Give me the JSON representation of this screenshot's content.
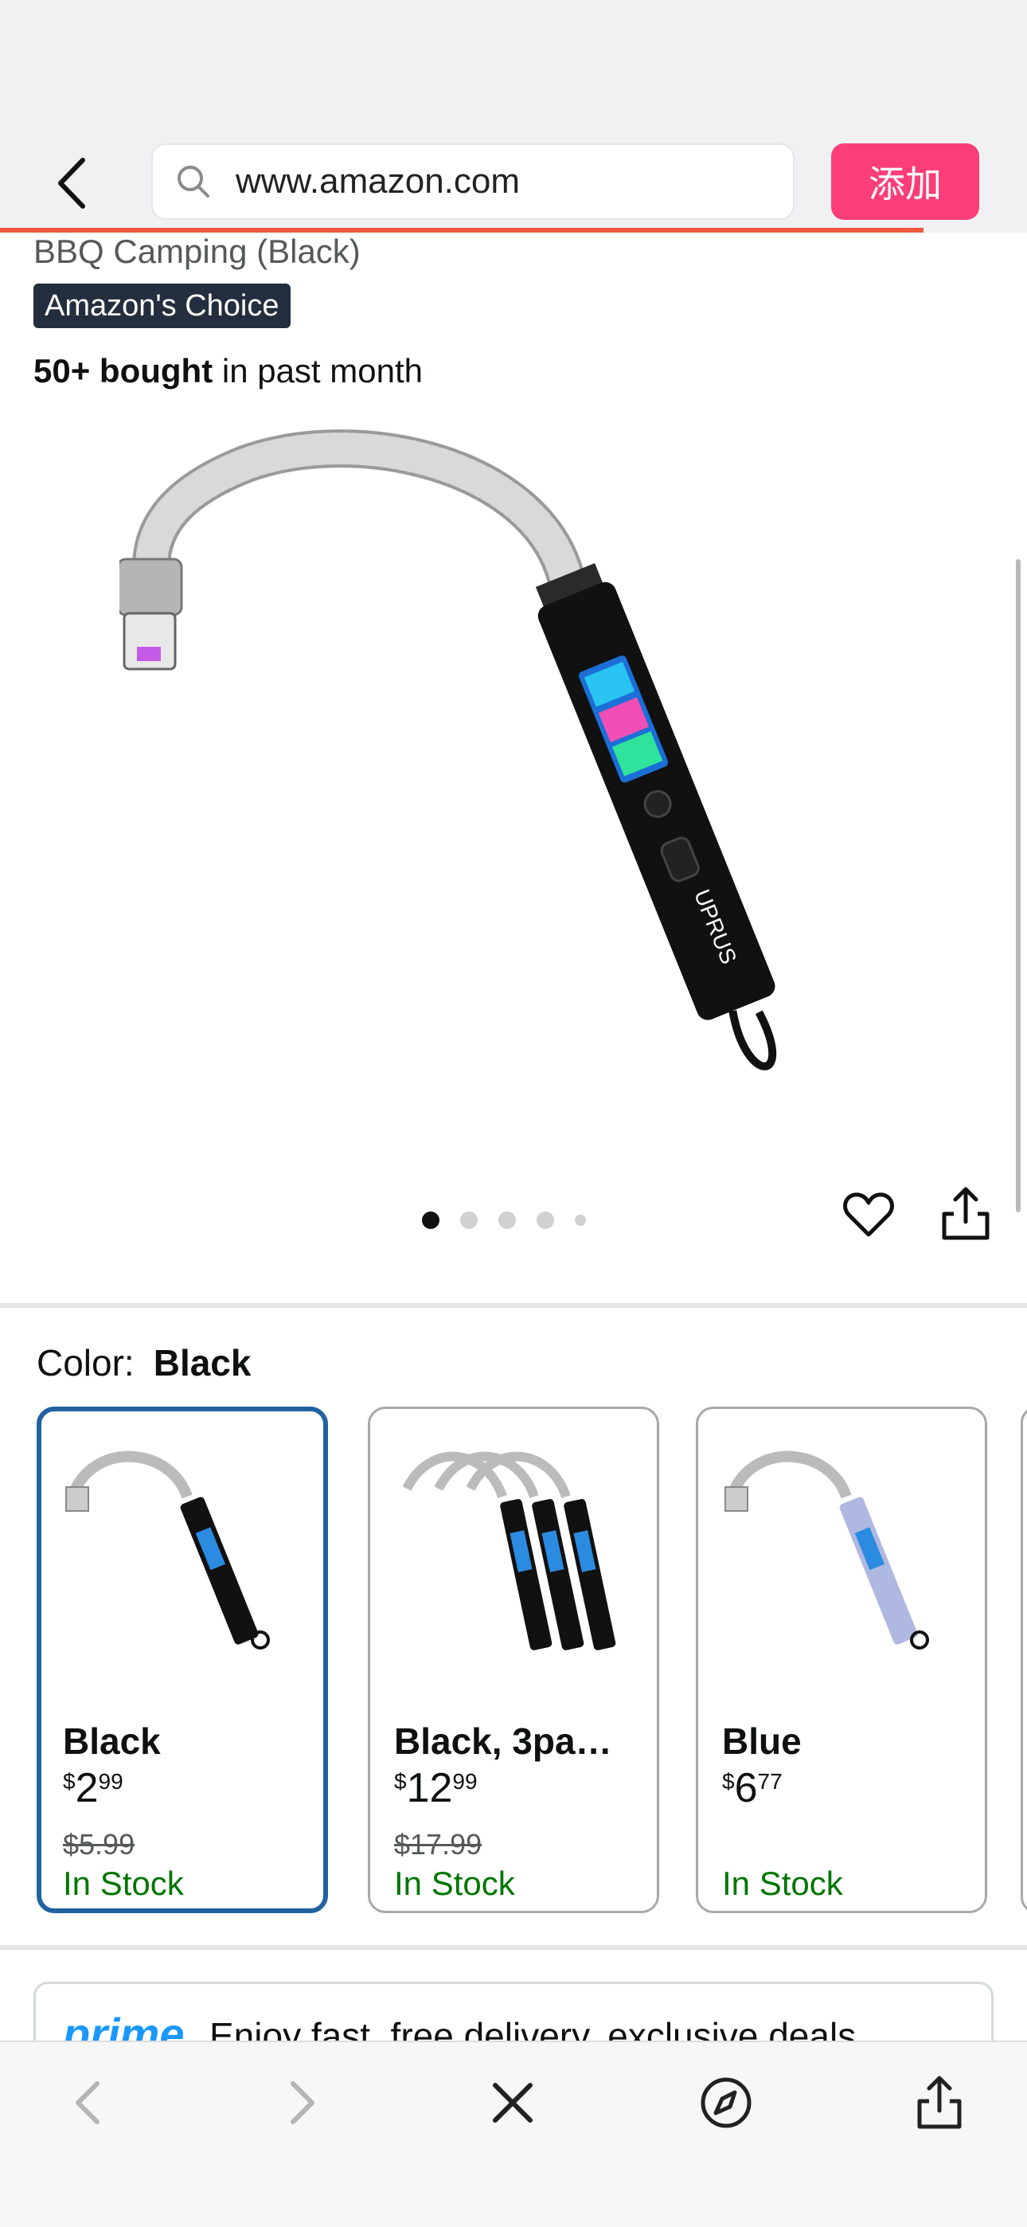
{
  "browser": {
    "url": "www.amazon.com",
    "add_button_label": "添加",
    "icons": {
      "back": "chevron-left-icon",
      "search": "search-icon"
    }
  },
  "product": {
    "title_fragment": "BBQ Camping (Black)",
    "badge": "Amazon's Choice",
    "bought_count": "50+ bought",
    "bought_suffix": " in past month",
    "gallery": {
      "total_images": 5,
      "current_index": 0
    },
    "selected_color_label": "Color:",
    "selected_color_value": "Black"
  },
  "swatches": [
    {
      "name": "Black",
      "currency": "$",
      "price_whole": "2",
      "price_fraction": "99",
      "was_price": "$5.99",
      "stock": "In Stock",
      "selected": true,
      "body_color": "#111111"
    },
    {
      "name": "Black, 3pa…",
      "currency": "$",
      "price_whole": "12",
      "price_fraction": "99",
      "was_price": "$17.99",
      "stock": "In Stock",
      "selected": false,
      "body_color": "#111111"
    },
    {
      "name": "Blue",
      "currency": "$",
      "price_whole": "6",
      "price_fraction": "77",
      "was_price": "",
      "stock": "In Stock",
      "selected": false,
      "body_color": "#aeb8e0"
    }
  ],
  "prime": {
    "logo": "prime",
    "text": "Enjoy fast, free delivery, exclusive deals"
  },
  "toolbar": {
    "icons": [
      "back-arrow-icon",
      "forward-arrow-icon",
      "close-icon",
      "compass-icon",
      "share-icon"
    ]
  },
  "colors": {
    "accent_pink": "#fb3e77",
    "progress_orange": "#f0583b",
    "selected_border": "#2162a1",
    "in_stock_green": "#007600",
    "prime_blue": "#1a98ff"
  }
}
